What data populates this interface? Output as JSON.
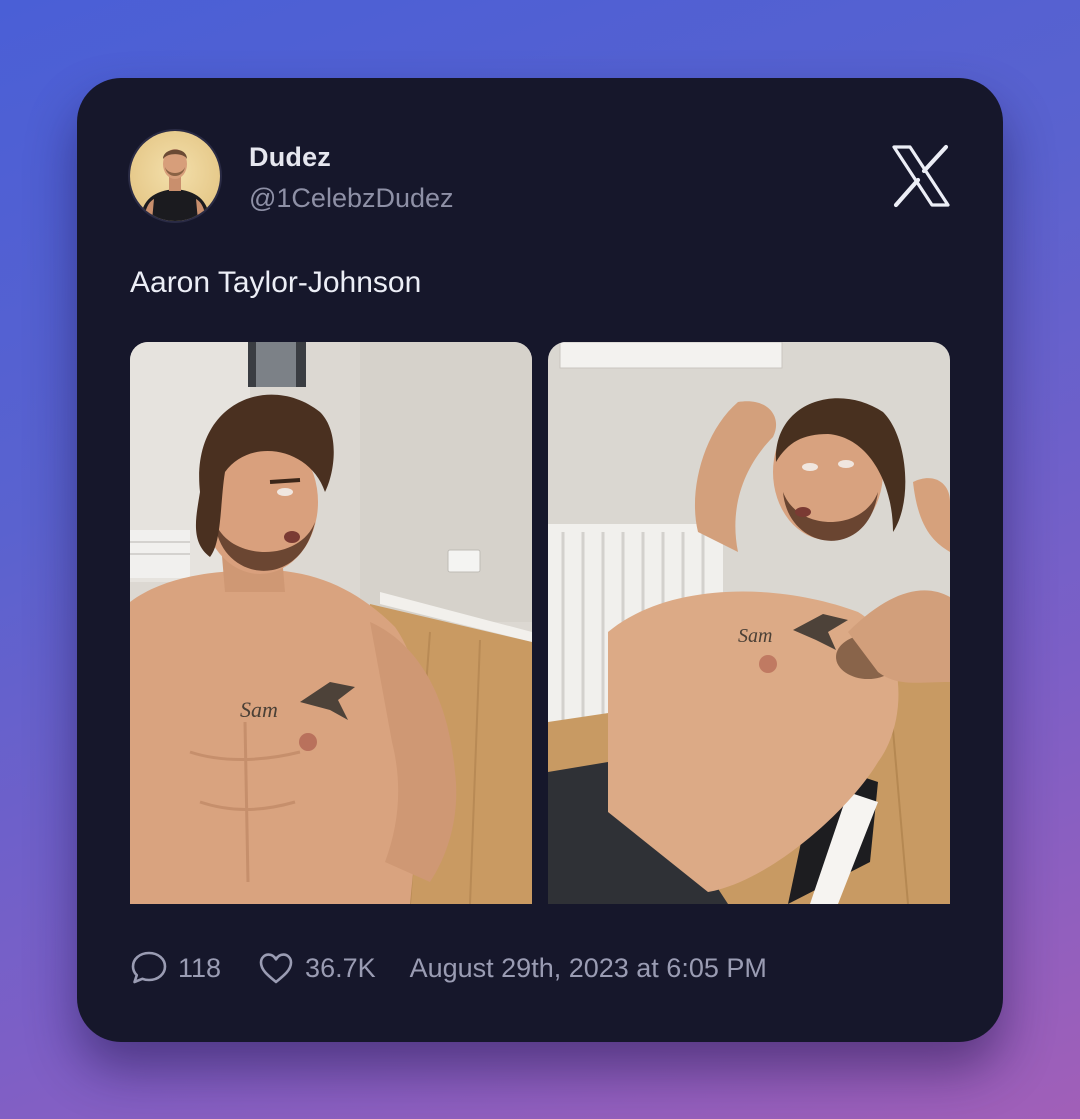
{
  "tweet": {
    "author": {
      "display_name": "Dudez",
      "handle": "@1CelebzDudez"
    },
    "text": "Aaron Taylor-Johnson",
    "media": [
      {
        "description": "photo-left"
      },
      {
        "description": "photo-right"
      }
    ],
    "stats": {
      "replies": "118",
      "likes": "36.7K"
    },
    "timestamp": "August 29th, 2023 at 6:05 PM"
  },
  "icons": {
    "platform_logo": "x-logo-icon",
    "reply": "speech-bubble-icon",
    "like": "heart-icon"
  },
  "colors": {
    "card_background": "#16172b",
    "text_primary": "#eceef6",
    "text_secondary": "#8e90a6",
    "page_gradient_start": "#4a5fd6",
    "page_gradient_end": "#a15fb8"
  }
}
